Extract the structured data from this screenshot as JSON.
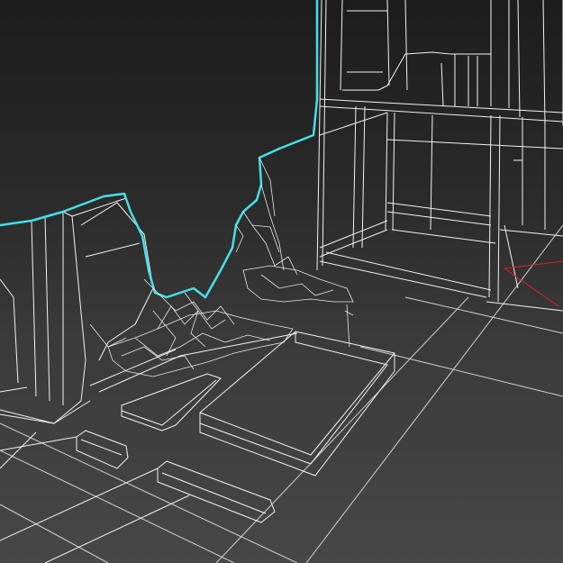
{
  "viewport": {
    "view_mode": "wireframe",
    "background_color": "#2b2b2b",
    "wire_color": "#ffffff",
    "selection_color": "#45e0e8",
    "axis_color": "#e02020"
  },
  "objects": [
    {
      "name": "cliff-wall",
      "selected": true
    },
    {
      "name": "building-frame",
      "selected": false
    },
    {
      "name": "debris-rocks",
      "selected": false
    },
    {
      "name": "floor-slabs",
      "selected": false
    }
  ]
}
